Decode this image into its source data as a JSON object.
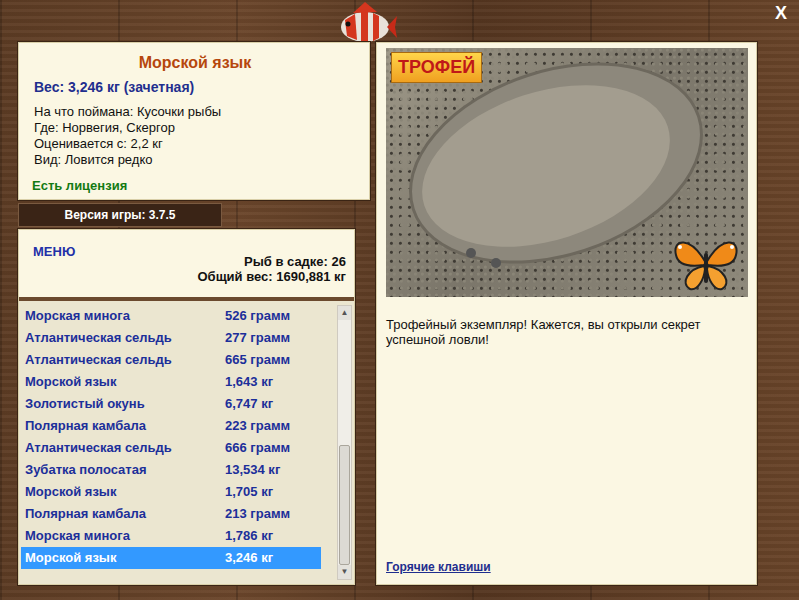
{
  "window": {
    "close": "X"
  },
  "fish": {
    "name": "Морской язык",
    "weight": "Вес: 3,246 кг (зачетная)",
    "details": [
      "На что поймана: Кусочки рыбы",
      "Где: Норвегия, Скергор",
      "Оценивается с: 2,2 кг",
      "Вид: Ловится редко"
    ],
    "license": "Есть лицензия"
  },
  "version": "Версия игры: 3.7.5",
  "menu": "МЕНЮ",
  "summary": [
    "Рыб в садке: 26",
    "Общий вес: 1690,881 кг"
  ],
  "catch": {
    "rows": [
      {
        "name": "Морская минога",
        "weight": "526 грамм",
        "selected": false
      },
      {
        "name": "Атлантическая сельдь",
        "weight": "277 грамм",
        "selected": false
      },
      {
        "name": "Атлантическая сельдь",
        "weight": "665 грамм",
        "selected": false
      },
      {
        "name": "Морской язык",
        "weight": "1,643 кг",
        "selected": false
      },
      {
        "name": "Золотистый окунь",
        "weight": "6,747 кг",
        "selected": false
      },
      {
        "name": "Полярная камбала",
        "weight": "223 грамм",
        "selected": false
      },
      {
        "name": "Атлантическая сельдь",
        "weight": "666 грамм",
        "selected": false
      },
      {
        "name": "Зубатка полосатая",
        "weight": "13,534 кг",
        "selected": false
      },
      {
        "name": "Морской язык",
        "weight": "1,705 кг",
        "selected": false
      },
      {
        "name": "Полярная камбала",
        "weight": "213 грамм",
        "selected": false
      },
      {
        "name": "Морская минога",
        "weight": "1,786 кг",
        "selected": false
      },
      {
        "name": "Морской язык",
        "weight": "3,246 кг",
        "selected": true
      }
    ],
    "scrollbar": {
      "level": 1
    }
  },
  "trophy": {
    "badge": "ТРОФЕЙ",
    "message": "Трофейный экземпляр! Кажется, вы открыли секрет успешной ловли!"
  },
  "hotkeys": "Горячие клавиши"
}
